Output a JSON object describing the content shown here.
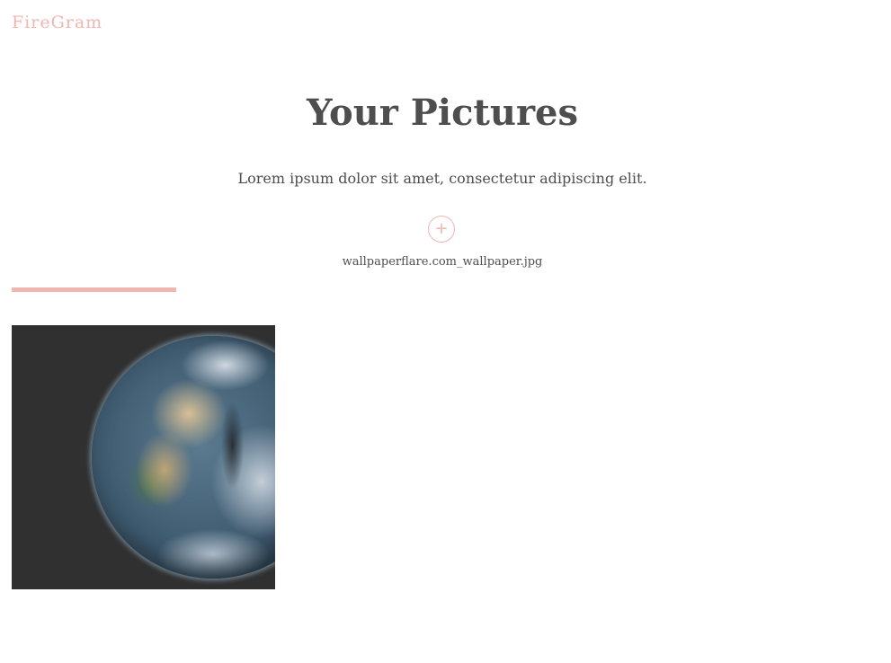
{
  "header": {
    "logo": "FireGram"
  },
  "main": {
    "title": "Your Pictures",
    "subtitle": "Lorem ipsum dolor sit amet, consectetur adipiscing elit.",
    "upload": {
      "icon": "plus-icon",
      "glyph": "+",
      "file_name": "wallpaperflare.com_wallpaper.jpg",
      "progress_percent": 19
    },
    "gallery": {
      "images": [
        {
          "subject": "earth-from-space"
        }
      ]
    }
  },
  "colors": {
    "accent": "#efb6b2",
    "text": "#4e4e4e",
    "tile_background": "#303030"
  }
}
